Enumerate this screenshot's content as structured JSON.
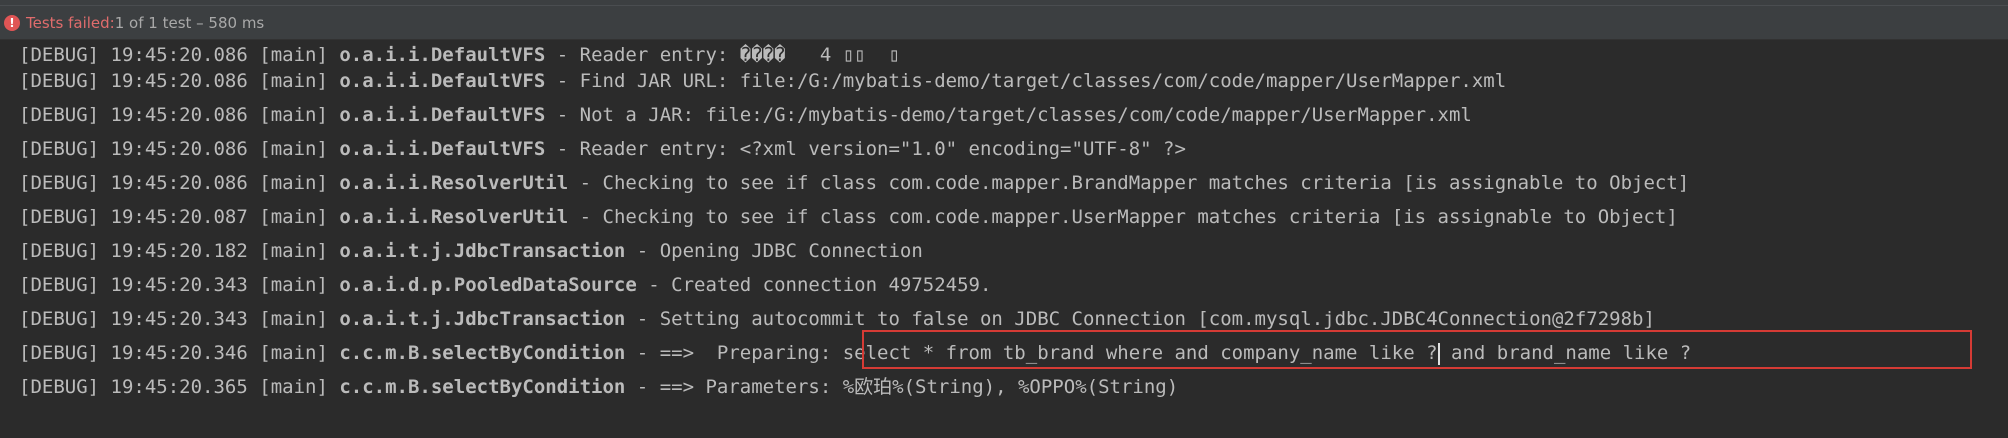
{
  "status": {
    "failed_label": "Tests failed:",
    "summary": " 1 of 1 test – 580 ms"
  },
  "icons": {
    "status": "error-circle-icon"
  },
  "colors": {
    "background": "#2b2b2b",
    "text": "#bbbbbb",
    "failed": "#e06c6c",
    "highlight_border": "#d53b35"
  },
  "log": {
    "lines": [
      {
        "level": "[DEBUG]",
        "time": "19:45:20.086",
        "thread": "[main]",
        "logger": "o.a.i.i.DefaultVFS",
        "message": "Reader entry: ����   4 ▯▯  ▯"
      },
      {
        "level": "[DEBUG]",
        "time": "19:45:20.086",
        "thread": "[main]",
        "logger": "o.a.i.i.DefaultVFS",
        "message": "Find JAR URL: file:/G:/mybatis-demo/target/classes/com/code/mapper/UserMapper.xml"
      },
      {
        "level": "[DEBUG]",
        "time": "19:45:20.086",
        "thread": "[main]",
        "logger": "o.a.i.i.DefaultVFS",
        "message": "Not a JAR: file:/G:/mybatis-demo/target/classes/com/code/mapper/UserMapper.xml"
      },
      {
        "level": "[DEBUG]",
        "time": "19:45:20.086",
        "thread": "[main]",
        "logger": "o.a.i.i.DefaultVFS",
        "message": "Reader entry: <?xml version=\"1.0\" encoding=\"UTF-8\" ?>"
      },
      {
        "level": "[DEBUG]",
        "time": "19:45:20.086",
        "thread": "[main]",
        "logger": "o.a.i.i.ResolverUtil",
        "message": "Checking to see if class com.code.mapper.BrandMapper matches criteria [is assignable to Object]"
      },
      {
        "level": "[DEBUG]",
        "time": "19:45:20.087",
        "thread": "[main]",
        "logger": "o.a.i.i.ResolverUtil",
        "message": "Checking to see if class com.code.mapper.UserMapper matches criteria [is assignable to Object]"
      },
      {
        "level": "[DEBUG]",
        "time": "19:45:20.182",
        "thread": "[main]",
        "logger": "o.a.i.t.j.JdbcTransaction",
        "message": "Opening JDBC Connection"
      },
      {
        "level": "[DEBUG]",
        "time": "19:45:20.343",
        "thread": "[main]",
        "logger": "o.a.i.d.p.PooledDataSource",
        "message": "Created connection 49752459."
      },
      {
        "level": "[DEBUG]",
        "time": "19:45:20.343",
        "thread": "[main]",
        "logger": "o.a.i.t.j.JdbcTransaction",
        "message": "Setting autocommit to false on JDBC Connection [com.mysql.jdbc.JDBC4Connection@2f7298b]"
      },
      {
        "level": "[DEBUG]",
        "time": "19:45:20.346",
        "thread": "[main]",
        "logger": "c.c.m.B.selectByCondition",
        "message_a": "==>  Preparing: select * from tb_brand where and company_name like ?",
        "message_b": " and brand_name like ?"
      },
      {
        "level": "[DEBUG]",
        "time": "19:45:20.365",
        "thread": "[main]",
        "logger": "c.c.m.B.selectByCondition",
        "message": "==> Parameters: %欧珀%(String), %OPPO%(String)"
      }
    ]
  }
}
